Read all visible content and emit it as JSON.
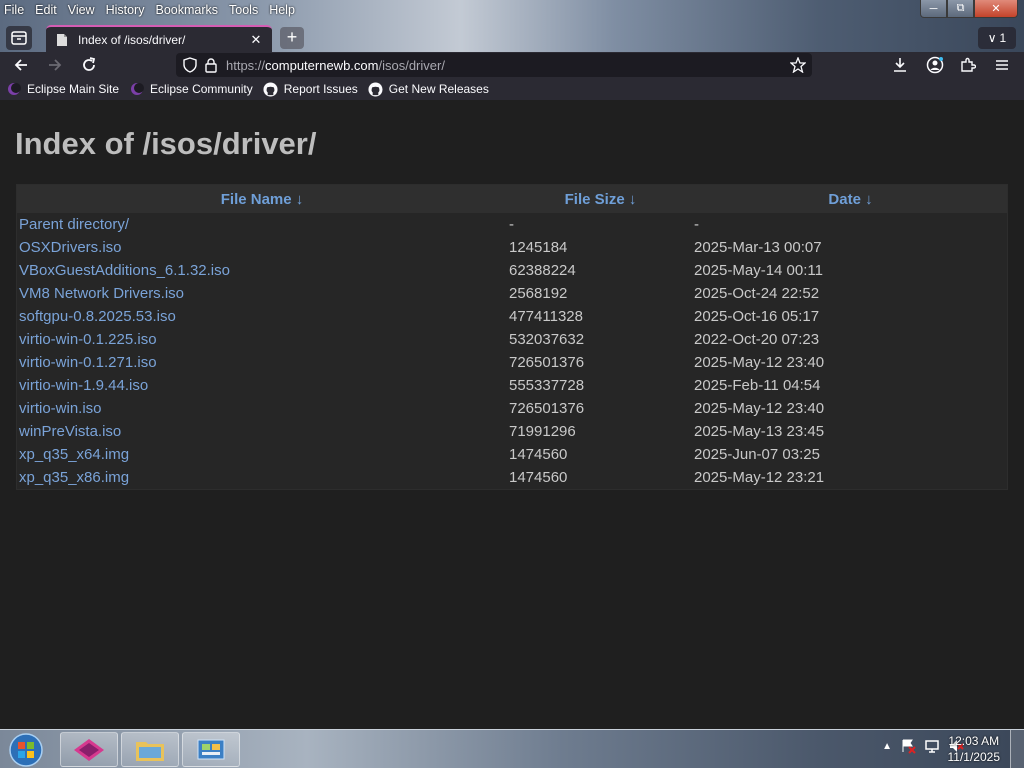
{
  "menubar": [
    {
      "label": "File"
    },
    {
      "label": "Edit"
    },
    {
      "label": "View"
    },
    {
      "label": "History"
    },
    {
      "label": "Bookmarks"
    },
    {
      "label": "Tools"
    },
    {
      "label": "Help"
    }
  ],
  "tabs": {
    "active_title": "Index of /isos/driver/",
    "overflow_count": "1"
  },
  "urlbar": {
    "scheme": "https://",
    "host": "computernewb.com",
    "path": "/isos/driver/"
  },
  "bookmarks": [
    {
      "label": "Eclipse Main Site",
      "icon": "eclipse-icon"
    },
    {
      "label": "Eclipse Community",
      "icon": "eclipse-icon"
    },
    {
      "label": "Report Issues",
      "icon": "github-icon"
    },
    {
      "label": "Get New Releases",
      "icon": "github-icon"
    }
  ],
  "page": {
    "heading": "Index of /isos/driver/",
    "columns": {
      "name": "File Name  ↓",
      "size": "File Size  ↓",
      "date": "Date  ↓"
    },
    "rows": [
      {
        "name": "Parent directory/",
        "size": "-",
        "date": "-"
      },
      {
        "name": "OSXDrivers.iso",
        "size": "1245184",
        "date": "2025-Mar-13 00:07"
      },
      {
        "name": "VBoxGuestAdditions_6.1.32.iso",
        "size": "62388224",
        "date": "2025-May-14 00:11"
      },
      {
        "name": "VM8 Network Drivers.iso",
        "size": "2568192",
        "date": "2025-Oct-24 22:52"
      },
      {
        "name": "softgpu-0.8.2025.53.iso",
        "size": "477411328",
        "date": "2025-Oct-16 05:17"
      },
      {
        "name": "virtio-win-0.1.225.iso",
        "size": "532037632",
        "date": "2022-Oct-20 07:23"
      },
      {
        "name": "virtio-win-0.1.271.iso",
        "size": "726501376",
        "date": "2025-May-12 23:40"
      },
      {
        "name": "virtio-win-1.9.44.iso",
        "size": "555337728",
        "date": "2025-Feb-11 04:54"
      },
      {
        "name": "virtio-win.iso",
        "size": "726501376",
        "date": "2025-May-12 23:40"
      },
      {
        "name": "winPreVista.iso",
        "size": "71991296",
        "date": "2025-May-13 23:45"
      },
      {
        "name": "xp_q35_x64.img",
        "size": "1474560",
        "date": "2025-Jun-07 03:25"
      },
      {
        "name": "xp_q35_x86.img",
        "size": "1474560",
        "date": "2025-May-12 23:21"
      }
    ]
  },
  "taskbar": {
    "time": "12:03 AM",
    "date": "11/1/2025"
  },
  "colors": {
    "link": "#7aa3d8",
    "tab_accent": "#d55db4",
    "page_bg": "#1f1f1f"
  }
}
